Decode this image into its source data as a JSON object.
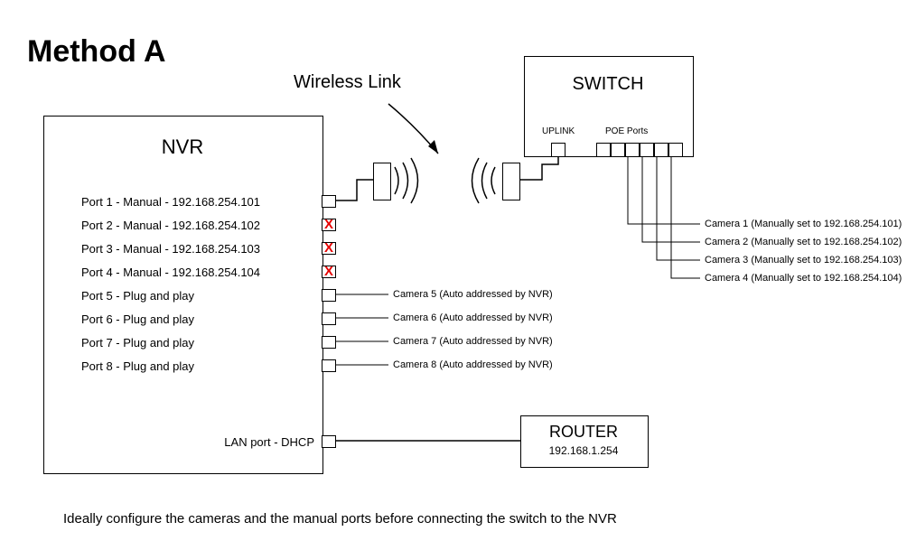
{
  "title": "Method A",
  "wireless_label": "Wireless Link",
  "nvr": {
    "title": "NVR",
    "ports": [
      "Port 1 - Manual - 192.168.254.101",
      "Port 2 - Manual - 192.168.254.102",
      "Port 3 - Manual - 192.168.254.103",
      "Port 4 - Manual - 192.168.254.104",
      "Port 5 - Plug and play",
      "Port 6 - Plug and play",
      "Port 7 - Plug and play",
      "Port 8 - Plug and play"
    ],
    "lan_label": "LAN port - DHCP"
  },
  "nvr_x_marks": [
    "X",
    "X",
    "X"
  ],
  "cam_auto": [
    "Camera 5 (Auto addressed by NVR)",
    "Camera 6 (Auto addressed by NVR)",
    "Camera 7 (Auto addressed by NVR)",
    "Camera 8 (Auto addressed by NVR)"
  ],
  "switch": {
    "title": "SWITCH",
    "uplink_label": "UPLINK",
    "poe_label": "POE Ports"
  },
  "cam_manual": [
    "Camera 1 (Manually set to 192.168.254.101)",
    "Camera 2 (Manually set to 192.168.254.102)",
    "Camera 3 (Manually set to 192.168.254.103)",
    "Camera 4 (Manually set to 192.168.254.104)"
  ],
  "router": {
    "title": "ROUTER",
    "ip": "192.168.1.254"
  },
  "footnote": "Ideally configure the cameras and the manual ports before connecting the switch to the NVR"
}
